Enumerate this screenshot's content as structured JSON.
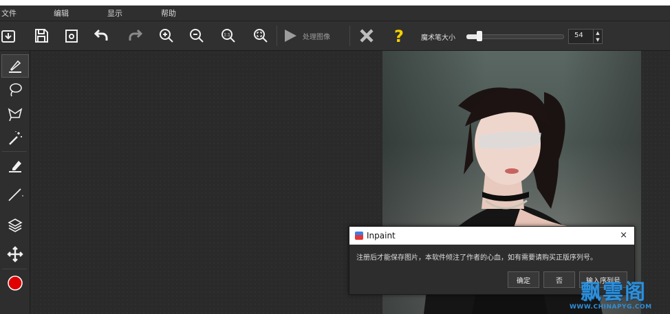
{
  "menu": {
    "file": "文件",
    "edit": "编辑",
    "view": "显示",
    "help": "帮助"
  },
  "toolbar": {
    "open_icon": "open-file-icon",
    "save_icon": "save-icon",
    "save_as_icon": "save-copy-icon",
    "undo_icon": "undo-icon",
    "redo_icon": "redo-icon",
    "zoom_in_icon": "zoom-in-icon",
    "zoom_out_icon": "zoom-out-icon",
    "zoom_actual_icon": "zoom-1to1-icon",
    "zoom_fit_icon": "zoom-fit-icon",
    "process_label": "处理图像",
    "cancel_icon": "x-icon",
    "help_icon": "question-icon",
    "magic_wand_size_label": "魔术笔大小",
    "magic_wand_size_value": "54",
    "magic_wand_size_fraction": 0.12
  },
  "tools": [
    {
      "name": "marker",
      "icon": "marker-pen-icon",
      "active": true
    },
    {
      "name": "lasso",
      "icon": "lasso-icon"
    },
    {
      "name": "polygon-lasso",
      "icon": "polygon-lasso-icon"
    },
    {
      "name": "magic-wand",
      "icon": "magic-wand-icon"
    },
    {
      "name": "eraser",
      "icon": "eraser-icon"
    },
    {
      "name": "line",
      "icon": "line-icon"
    },
    {
      "name": "layers",
      "icon": "layers-icon"
    },
    {
      "name": "move",
      "icon": "move-arrows-icon"
    },
    {
      "name": "color",
      "icon": "color-dot-icon",
      "color": "#e00000"
    }
  ],
  "dialog": {
    "title": "Inpaint",
    "close": "×",
    "message": "注册后才能保存图片，本软件倾注了作者的心血，如有需要请购买正版序列号。",
    "buttons": {
      "ok": "确定",
      "no": "否",
      "serial": "输入序列号"
    }
  },
  "watermark": {
    "text": "飘雲阁",
    "url": "WWW.CHINAPYG.COM"
  },
  "colors": {
    "background": "#2b2b2b",
    "toolbar": "#303030",
    "accent_yellow": "#f5d000",
    "watermark_blue": "#2f8fd8"
  }
}
